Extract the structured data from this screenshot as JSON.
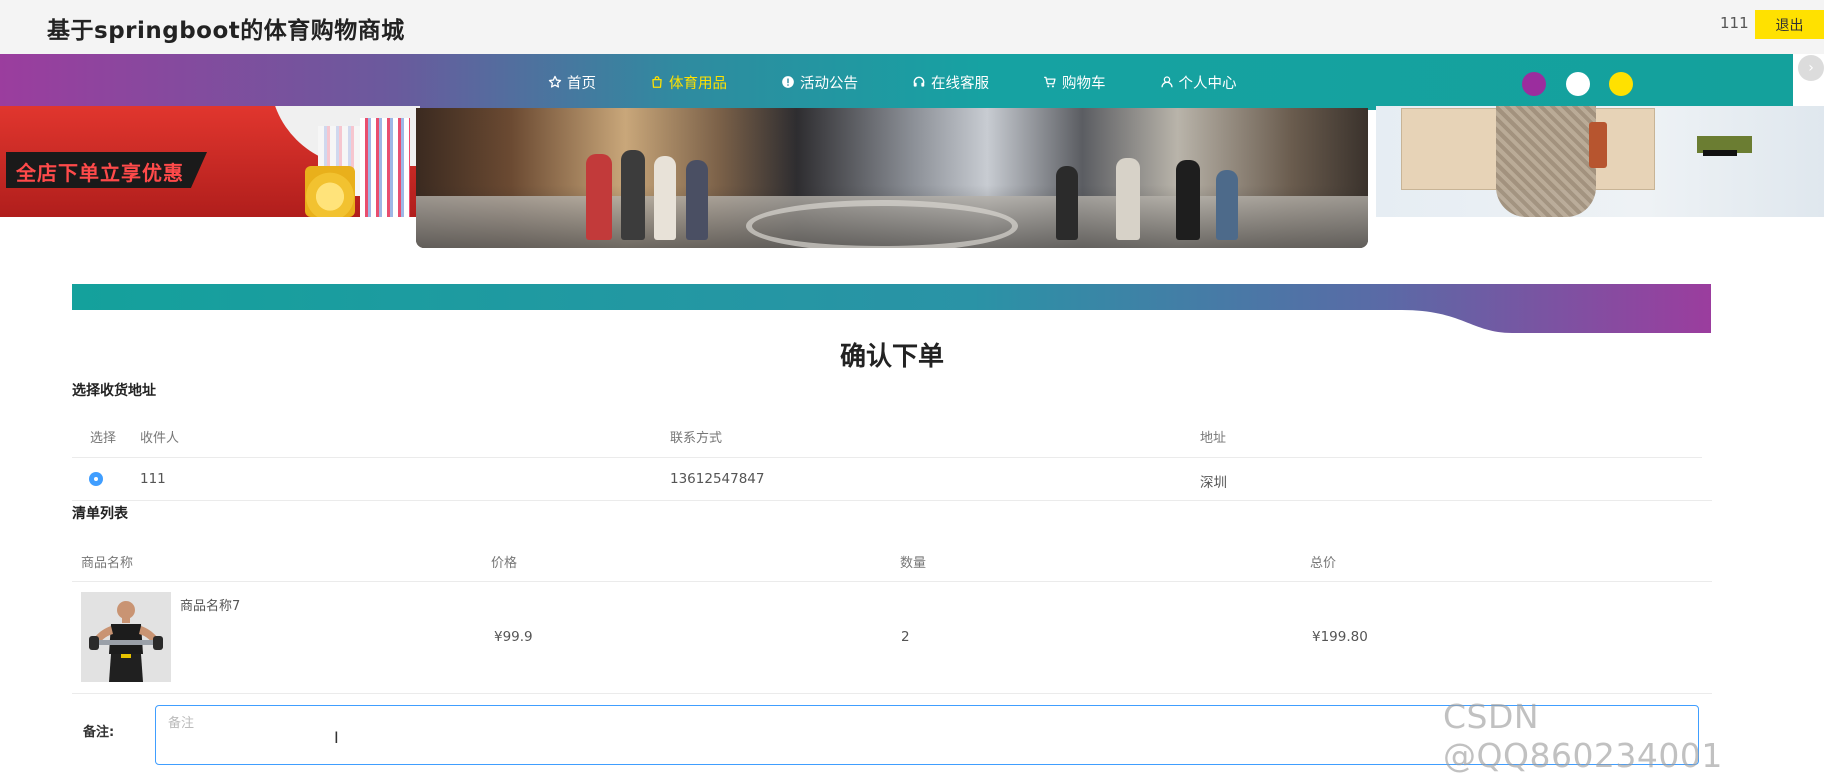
{
  "header": {
    "site_title": "基于springboot的体育购物商城",
    "user_name": "111",
    "logout_label": "退出"
  },
  "nav": {
    "items": [
      {
        "label": "首页",
        "icon": "star-icon",
        "active": false
      },
      {
        "label": "体育用品",
        "icon": "bag-icon",
        "active": true
      },
      {
        "label": "活动公告",
        "icon": "info-icon",
        "active": false
      },
      {
        "label": "在线客服",
        "icon": "headset-icon",
        "active": false
      },
      {
        "label": "购物车",
        "icon": "cart-icon",
        "active": false
      },
      {
        "label": "个人中心",
        "icon": "user-icon",
        "active": false
      }
    ],
    "theme_dots": [
      "#9b2d9e",
      "#ffffff",
      "#ffe100"
    ]
  },
  "banner": {
    "promo_text": "全店下单立享优惠"
  },
  "page": {
    "heading": "确认下单",
    "address_section_label": "选择收货地址",
    "list_section_label": "清单列表"
  },
  "address_table": {
    "headers": [
      "选择",
      "收件人",
      "联系方式",
      "地址"
    ],
    "rows": [
      {
        "selected": true,
        "recipient": "111",
        "phone": "13612547847",
        "address": "深圳"
      }
    ]
  },
  "order_table": {
    "headers": [
      "商品名称",
      "价格",
      "数量",
      "总价"
    ],
    "rows": [
      {
        "name": "商品名称7",
        "price": "¥99.9",
        "quantity": "2",
        "total": "¥199.80"
      }
    ]
  },
  "remark": {
    "label": "备注:",
    "placeholder": "备注",
    "value": ""
  },
  "watermark": "CSDN @QQ860234001",
  "colors": {
    "accent_yellow": "#ffe100",
    "radio_blue": "#409eff",
    "teal": "#16a2a2",
    "purple": "#9b3d9e"
  }
}
